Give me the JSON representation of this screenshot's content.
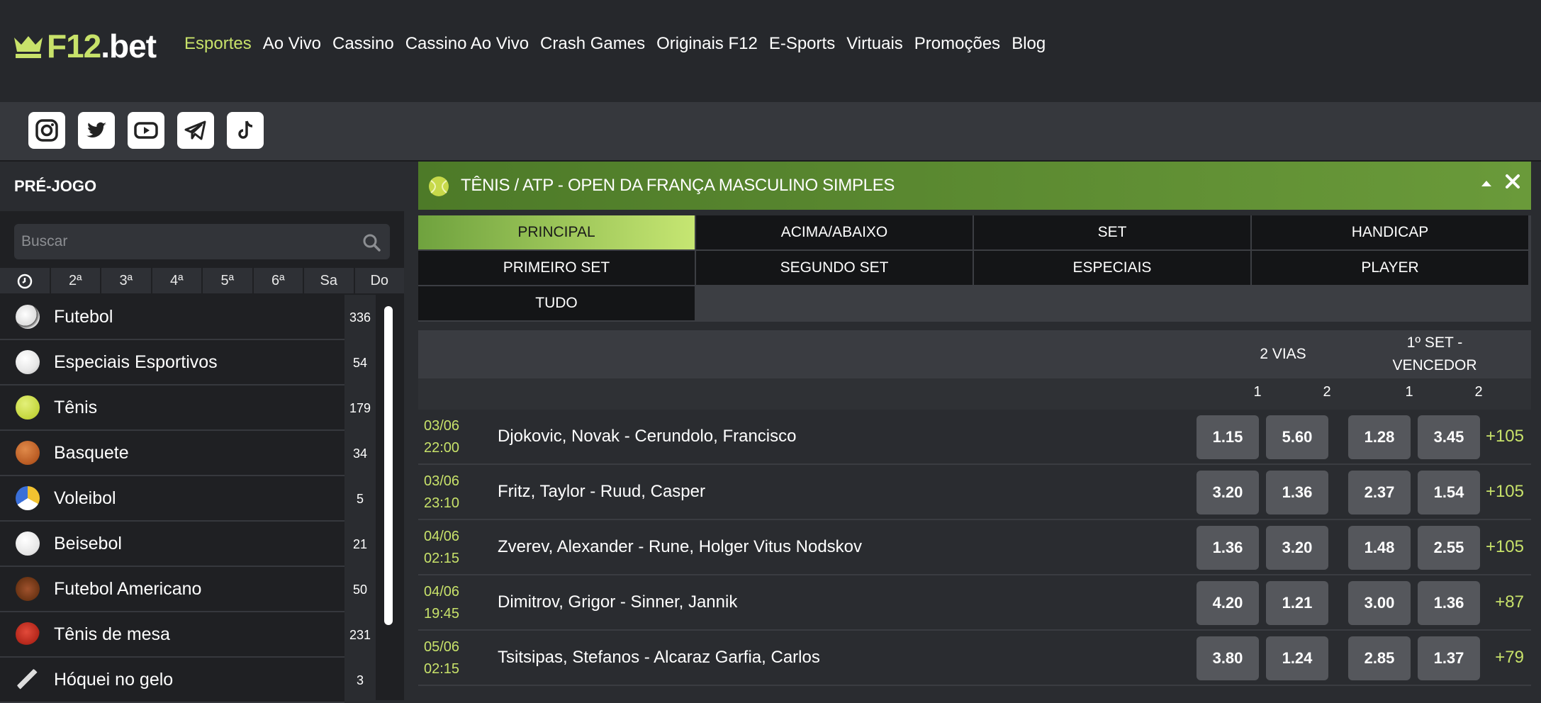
{
  "header": {
    "logo": {
      "f12": "F12",
      "dotbet": ".bet"
    },
    "nav": [
      "Esportes",
      "Ao Vivo",
      "Cassino",
      "Cassino Ao Vivo",
      "Crash Games",
      "Originais F12",
      "E-Sports",
      "Virtuais",
      "Promoções",
      "Blog"
    ],
    "active_nav": "Esportes",
    "social": [
      "instagram-icon",
      "twitter-icon",
      "youtube-icon",
      "telegram-icon",
      "tiktok-icon"
    ]
  },
  "sidebar": {
    "title": "PRÉ-JOGO",
    "search": {
      "placeholder": "Buscar",
      "value": ""
    },
    "day_tabs": [
      "2ª",
      "3ª",
      "4ª",
      "5ª",
      "6ª",
      "Sa",
      "Do"
    ],
    "sports": [
      {
        "name": "Futebol",
        "count": "336",
        "icon": "soccer-ball-icon"
      },
      {
        "name": "Especiais Esportivos",
        "count": "54",
        "icon": "white-ball-icon"
      },
      {
        "name": "Tênis",
        "count": "179",
        "icon": "tennis-ball-icon"
      },
      {
        "name": "Basquete",
        "count": "34",
        "icon": "basketball-icon"
      },
      {
        "name": "Voleibol",
        "count": "5",
        "icon": "volleyball-icon"
      },
      {
        "name": "Beisebol",
        "count": "21",
        "icon": "baseball-icon"
      },
      {
        "name": "Futebol Americano",
        "count": "50",
        "icon": "american-football-icon"
      },
      {
        "name": "Tênis de mesa",
        "count": "231",
        "icon": "table-tennis-icon"
      },
      {
        "name": "Hóquei no gelo",
        "count": "3",
        "icon": "ice-hockey-icon"
      }
    ]
  },
  "main": {
    "league_title": "TÊNIS / ATP - OPEN DA FRANÇA MASCULINO SIMPLES",
    "market_tabs": [
      "PRINCIPAL",
      "ACIMA/ABAIXO",
      "SET",
      "HANDICAP",
      "PRIMEIRO SET",
      "SEGUNDO SET",
      "ESPECIAIS",
      "PLAYER",
      "TUDO"
    ],
    "active_tab": "PRINCIPAL",
    "columns": {
      "group1": "2 VIAS",
      "group2_line1": "1º SET -",
      "group2_line2": "VENCEDOR",
      "sub": [
        "1",
        "2",
        "1",
        "2"
      ]
    },
    "matches": [
      {
        "date": "03/06",
        "time": "22:00",
        "teams": "Djokovic, Novak - Cerundolo, Francisco",
        "odds": [
          "1.15",
          "5.60",
          "1.28",
          "3.45"
        ],
        "more": "+105"
      },
      {
        "date": "03/06",
        "time": "23:10",
        "teams": "Fritz, Taylor - Ruud, Casper",
        "odds": [
          "3.20",
          "1.36",
          "2.37",
          "1.54"
        ],
        "more": "+105"
      },
      {
        "date": "04/06",
        "time": "02:15",
        "teams": "Zverev, Alexander - Rune, Holger Vitus Nodskov",
        "odds": [
          "1.36",
          "3.20",
          "1.48",
          "2.55"
        ],
        "more": "+105"
      },
      {
        "date": "04/06",
        "time": "19:45",
        "teams": "Dimitrov, Grigor - Sinner, Jannik",
        "odds": [
          "4.20",
          "1.21",
          "3.00",
          "1.36"
        ],
        "more": "+87"
      },
      {
        "date": "05/06",
        "time": "02:15",
        "teams": "Tsitsipas, Stefanos - Alcaraz Garfia, Carlos",
        "odds": [
          "3.80",
          "1.24",
          "2.85",
          "1.37"
        ],
        "more": "+79"
      }
    ]
  },
  "colors": {
    "accent": "#c8e26a",
    "league_bar": "#5a8a30",
    "odd_button": "#55575c"
  }
}
